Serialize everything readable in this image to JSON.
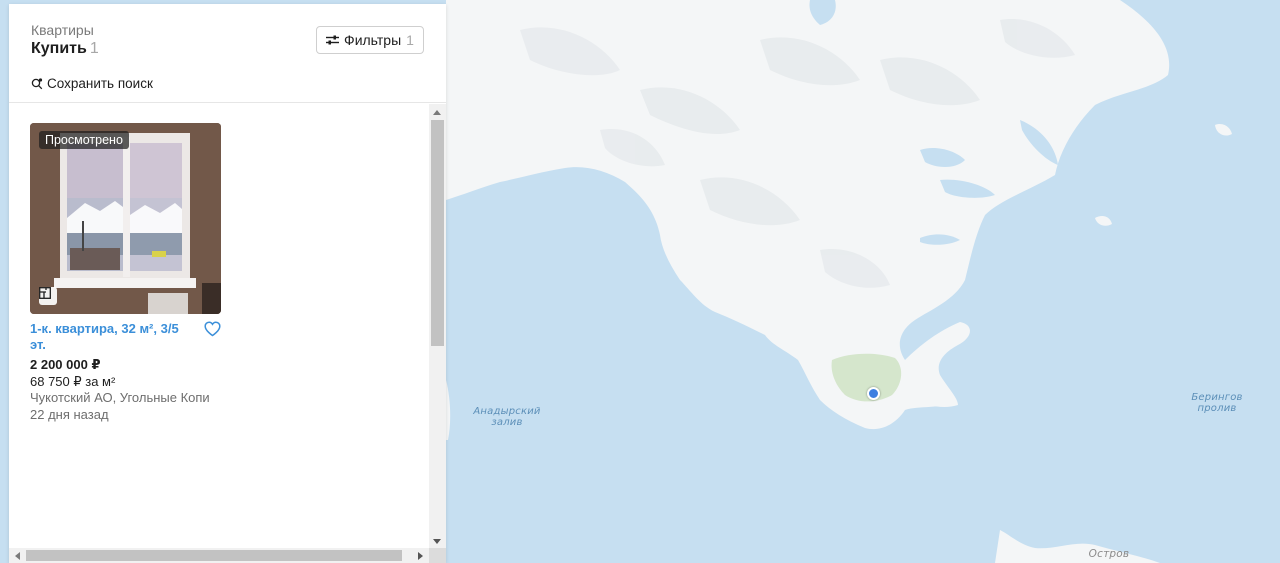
{
  "header": {
    "category": "Квартиры",
    "deal": "Купить",
    "deal_count": "1",
    "filters_label": "Фильтры",
    "filters_count": "1",
    "save_search_label": "Сохранить поиск"
  },
  "listing": {
    "viewed_badge": "Просмотрено",
    "title": "1-к. квартира, 32 м², 3/5 эт.",
    "price": "2 200 000 ₽",
    "price_per_m2": "68 750 ₽ за м²",
    "address": "Чукотский АО, Угольные Копи",
    "date": "22 дня назад"
  },
  "map": {
    "labels": {
      "gulf_line1": "Анадырский",
      "gulf_line2": "залив",
      "strait_line1": "Берингов",
      "strait_line2": "пролив",
      "island": "Остров"
    },
    "colors": {
      "sea": "#c6dff1",
      "land": "#f4f6f7",
      "marker": "#3d7fe0",
      "link": "#3b8fd9"
    }
  },
  "icons": {
    "filter": "sliders-icon",
    "save": "search-bell-icon",
    "plan": "floor-plan-icon",
    "favorite": "heart-icon",
    "marker": "location-dot-icon"
  }
}
